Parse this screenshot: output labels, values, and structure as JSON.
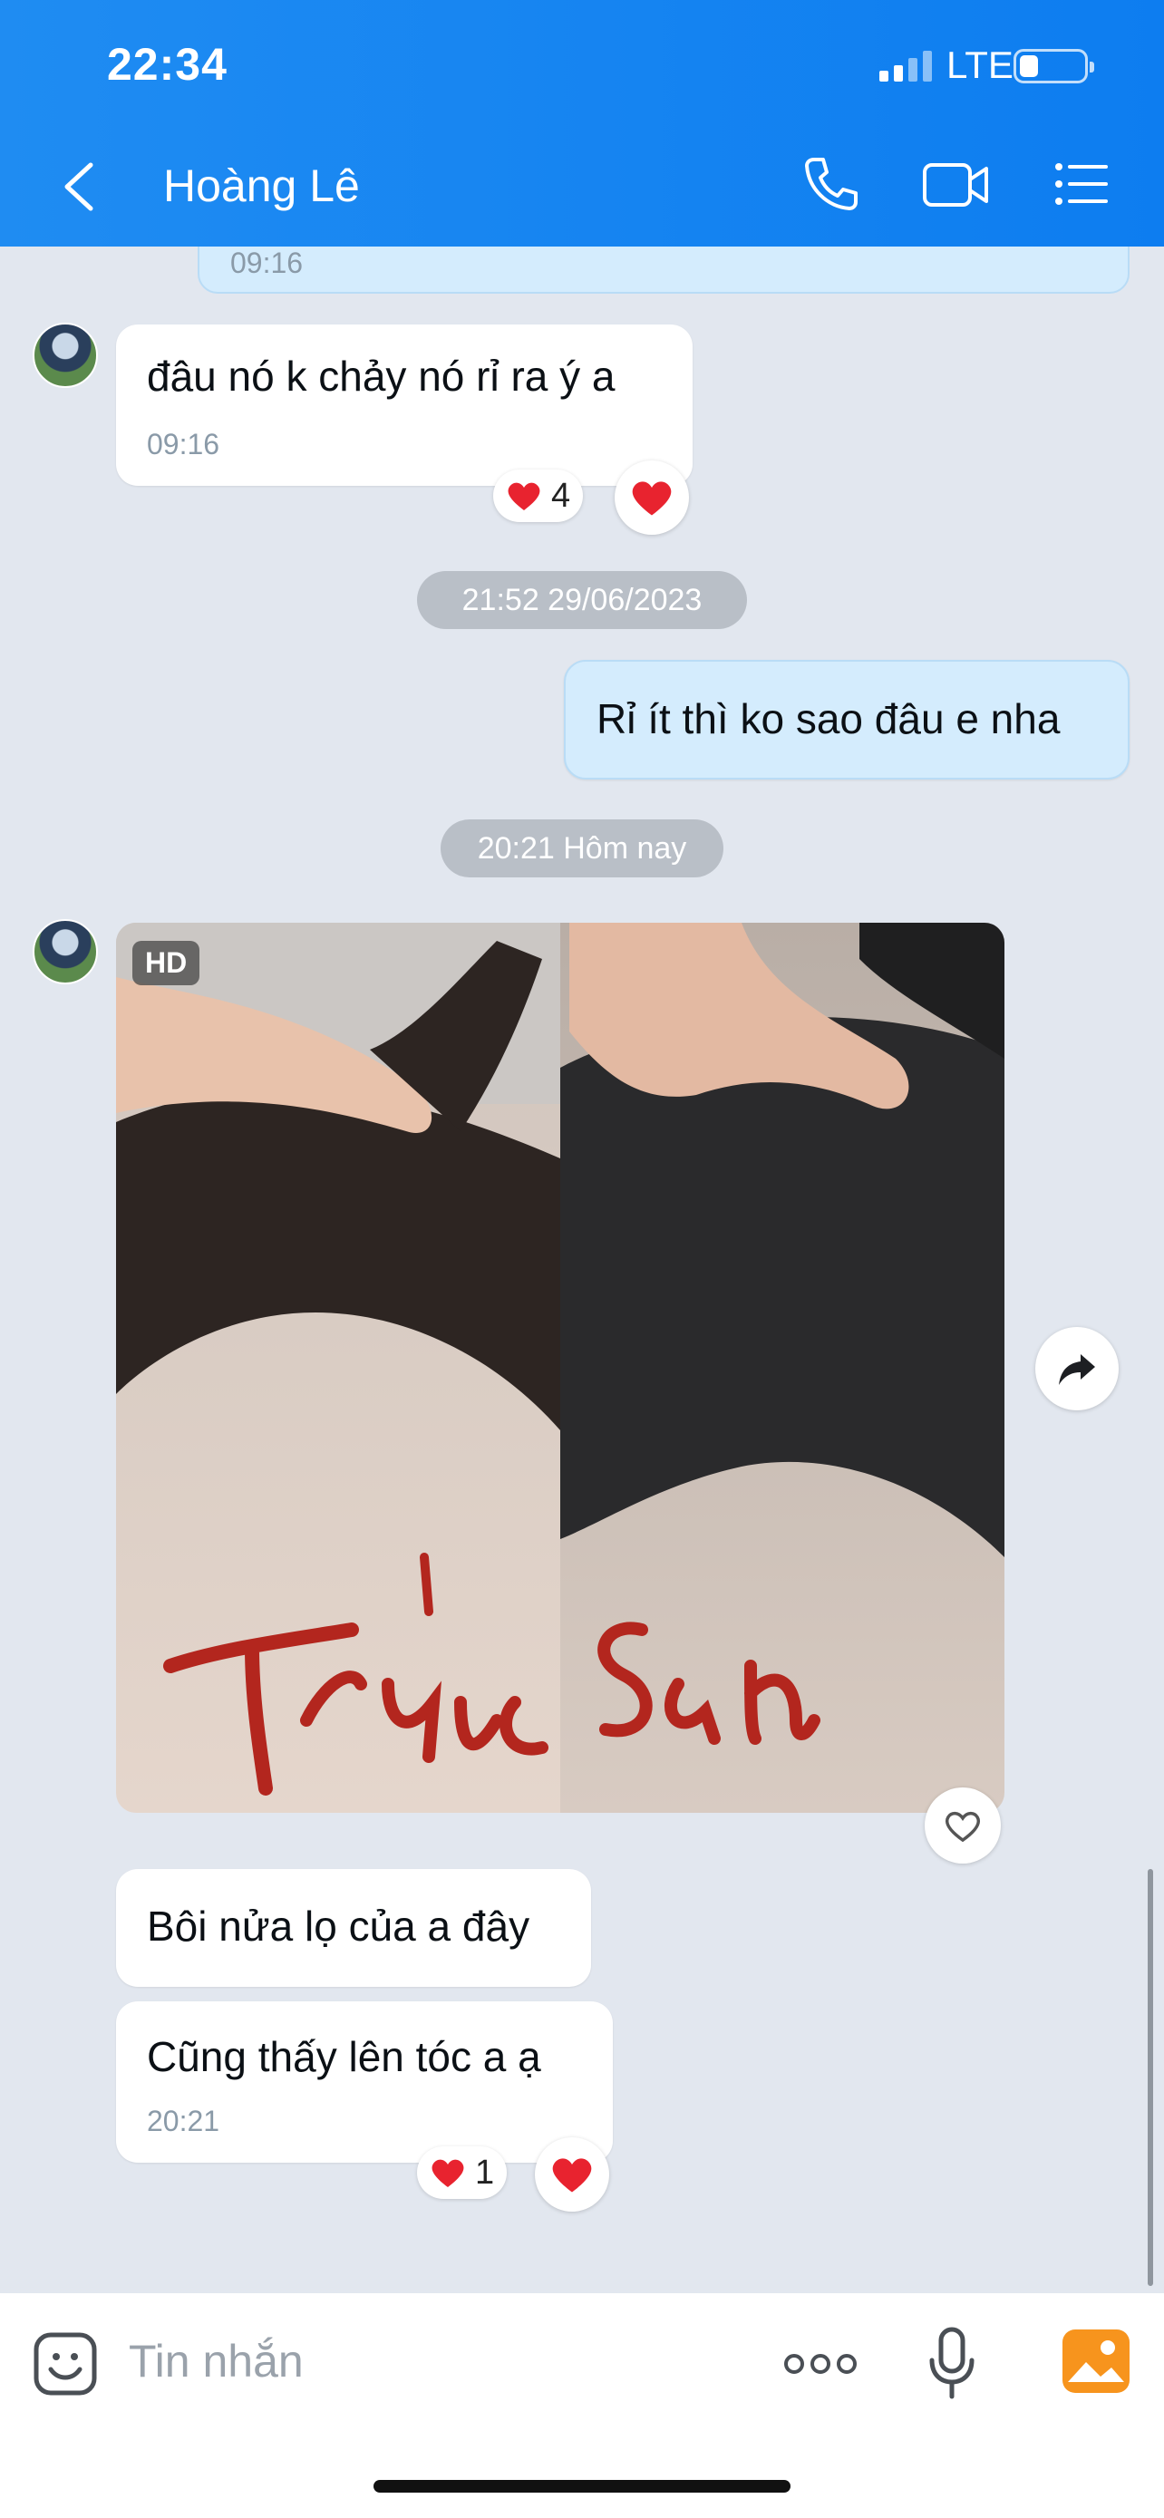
{
  "status_bar": {
    "time": "22:34",
    "network": "LTE"
  },
  "header": {
    "title": "Hoàng Lê"
  },
  "messages": {
    "prev_out_time": "09:16",
    "m1": {
      "text": "đâu nó k chảy nó rỉ ra ý a",
      "time": "09:16",
      "reaction_count": "4"
    },
    "date1": "21:52 29/06/2023",
    "m2": {
      "text": "Rỉ ít thì ko sao đâu e nha"
    },
    "date2": "20:21 Hôm nay",
    "photo": {
      "badge": "HD"
    },
    "m3": {
      "text": "Bôi nửa lọ của a đây"
    },
    "m4": {
      "text": "Cũng thấy lên tóc a ạ",
      "time": "20:21",
      "reaction_count": "1"
    }
  },
  "input": {
    "placeholder": "Tin nhắn"
  },
  "colors": {
    "header": "#1f8cf2",
    "background": "#e2e7ef",
    "outgoing": "#d4ecfd",
    "heart": "#e8232f"
  }
}
